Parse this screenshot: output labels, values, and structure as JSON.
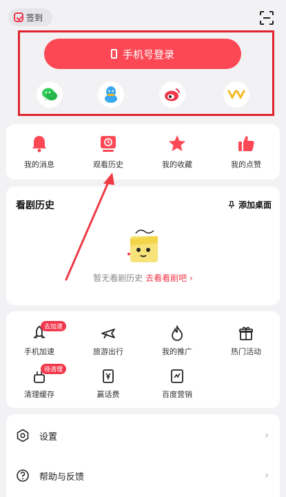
{
  "topbar": {
    "checkin_label": "签到",
    "scan_icon": "scan-icon"
  },
  "login": {
    "button_label": "手机号登录",
    "social": [
      "wechat",
      "qq",
      "weibo",
      "yy"
    ]
  },
  "quick": [
    {
      "label": "我的消息",
      "icon": "bell-icon"
    },
    {
      "label": "观看历史",
      "icon": "history-icon"
    },
    {
      "label": "我的收藏",
      "icon": "star-icon"
    },
    {
      "label": "我的点赞",
      "icon": "thumb-icon"
    }
  ],
  "history": {
    "title": "看剧历史",
    "add_desktop": "添加桌面",
    "empty_text": "暂无看剧历史",
    "empty_link": "去看看剧吧",
    "empty_link_arrow": "›"
  },
  "services": [
    {
      "label": "手机加速",
      "badge": "去加速"
    },
    {
      "label": "旅游出行",
      "badge": ""
    },
    {
      "label": "我的推广",
      "badge": ""
    },
    {
      "label": "热门活动",
      "badge": ""
    },
    {
      "label": "清理缓存",
      "badge": "待清理"
    },
    {
      "label": "赢话费",
      "badge": ""
    },
    {
      "label": "百度营销",
      "badge": ""
    }
  ],
  "settings": [
    {
      "label": "设置",
      "chevron": "›"
    },
    {
      "label": "帮助与反馈",
      "chevron": "›"
    }
  ],
  "colors": {
    "accent": "#fb4854",
    "highlight": "#e0242e",
    "background": "#f2f2f4"
  }
}
